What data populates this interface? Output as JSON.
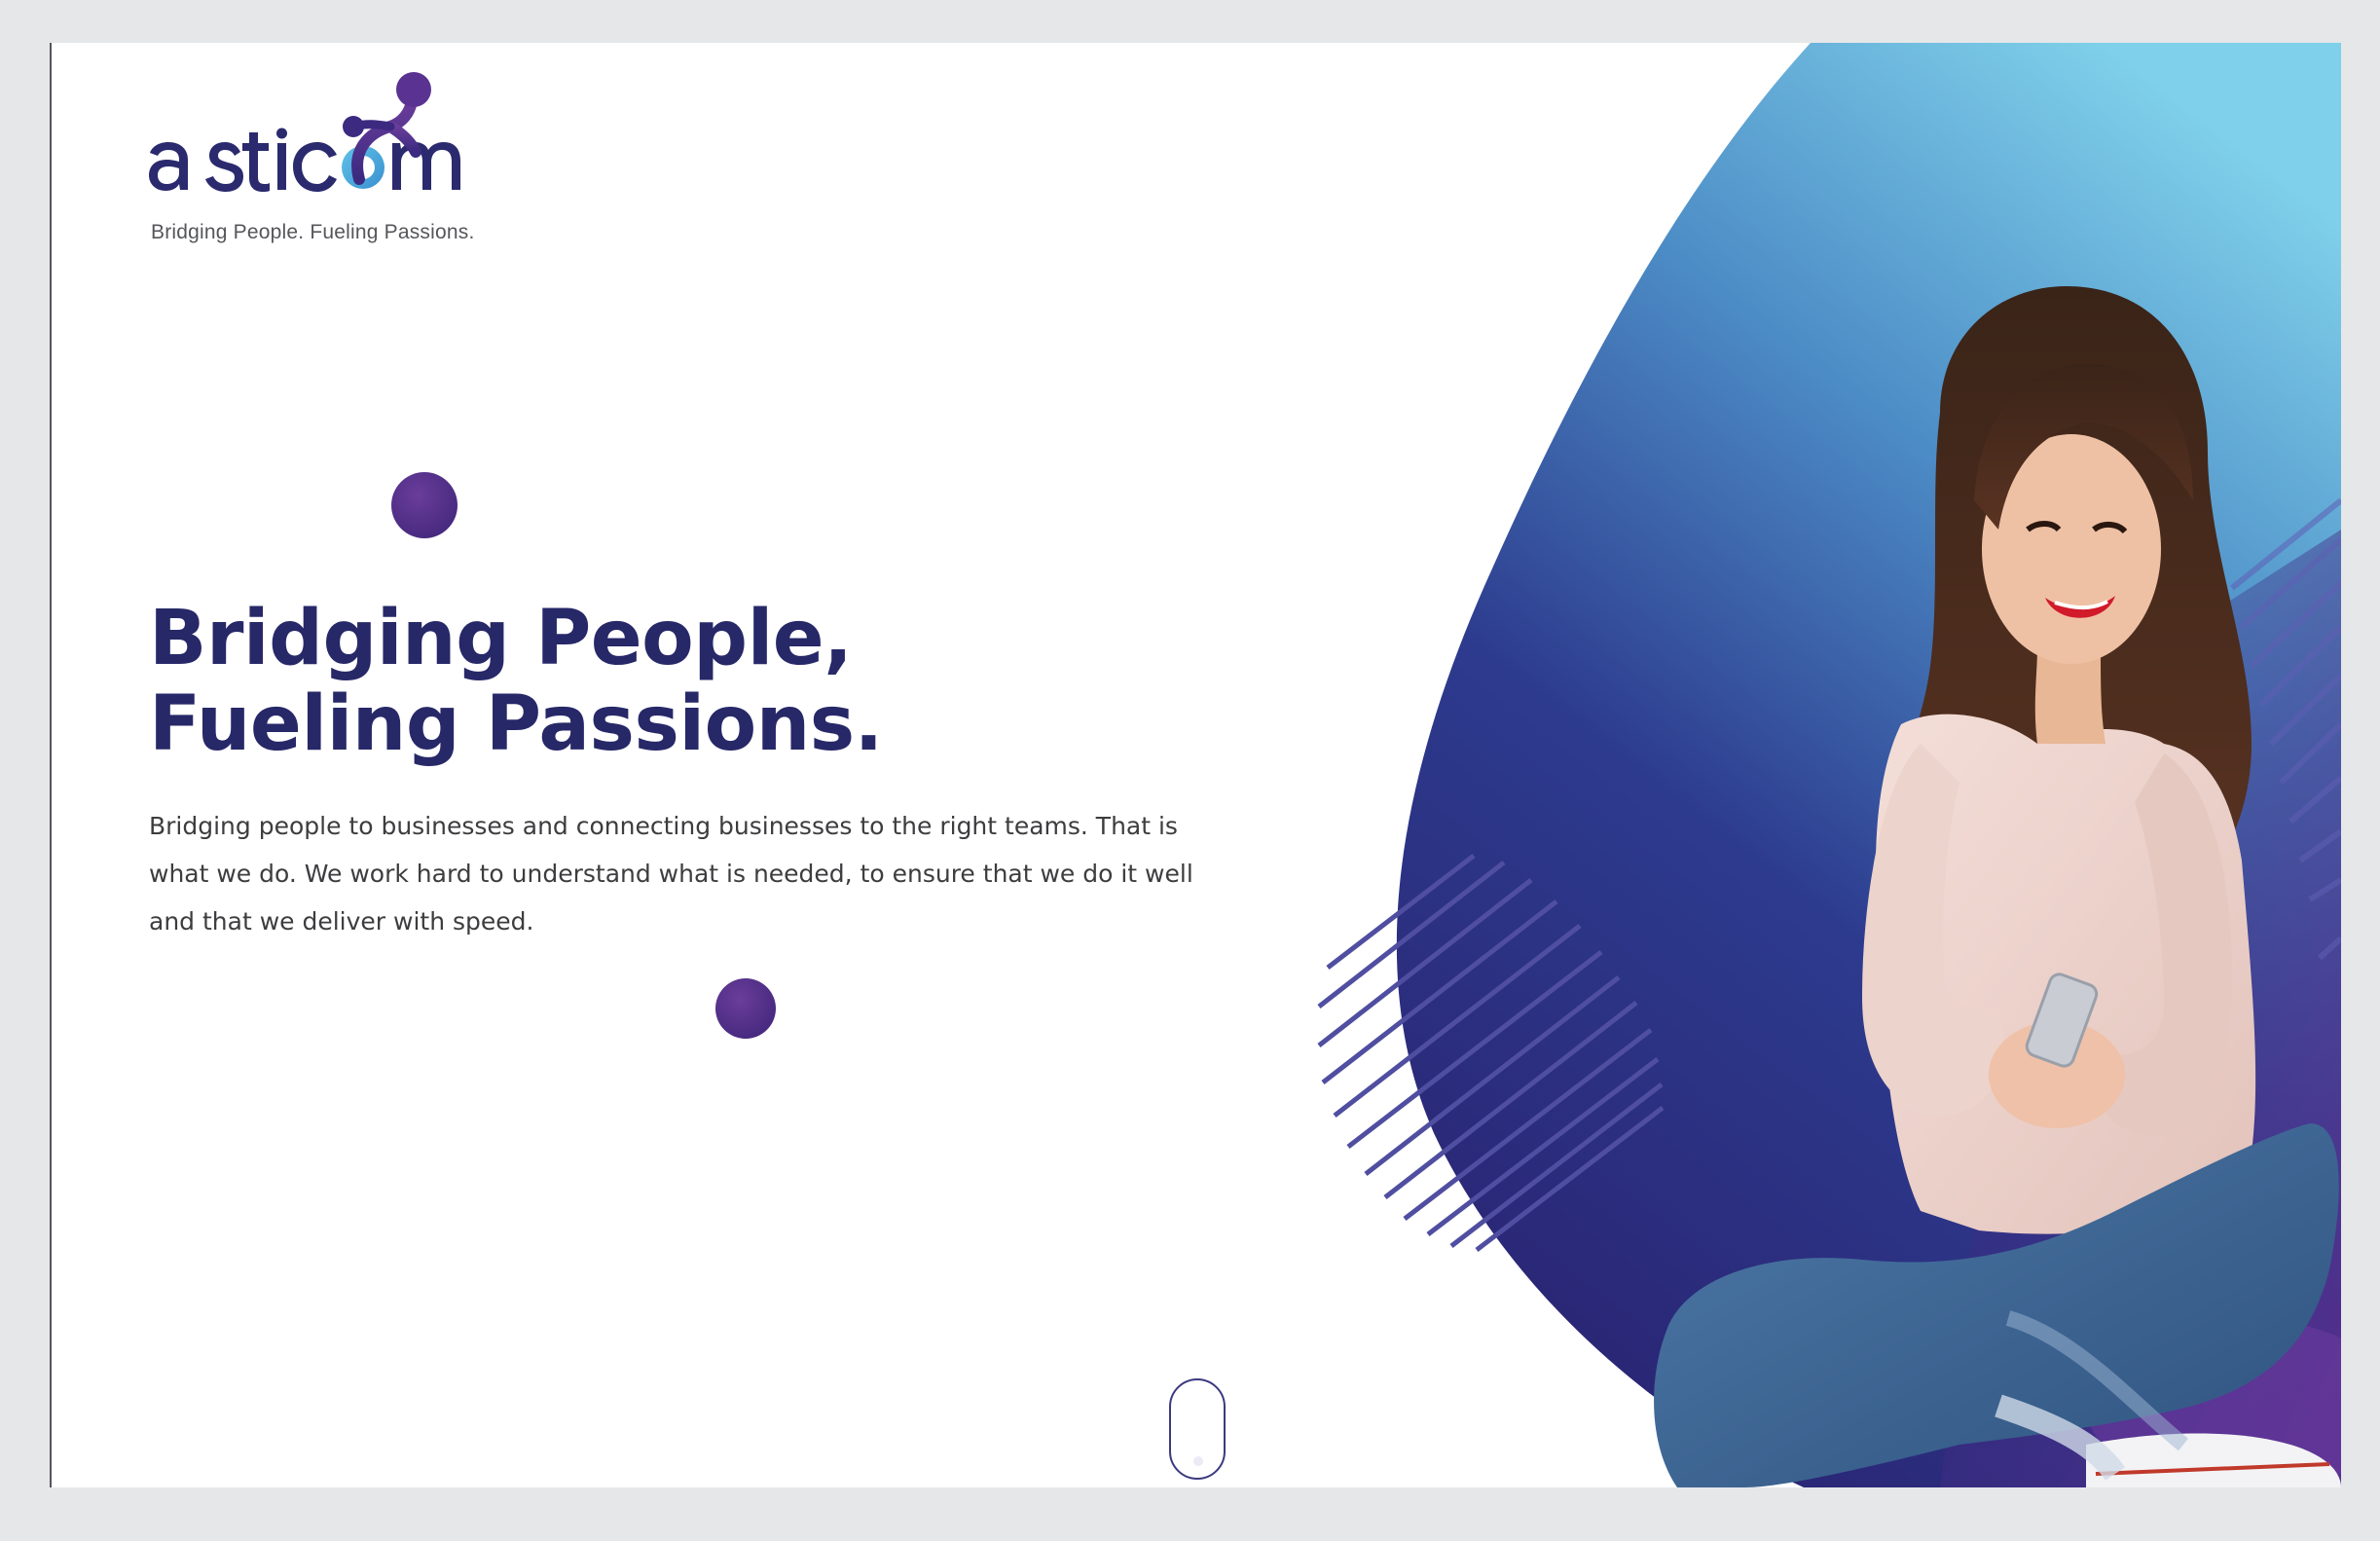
{
  "brand": {
    "logo_text": "asticom",
    "tagline": "Bridging People. Fueling Passions.",
    "primary_color": "#272868",
    "accent_purple": "#4a2b82",
    "gradient_light": "#7ccce6",
    "gradient_dark": "#2a2a7a"
  },
  "hero": {
    "title_line1": "Bridging People,",
    "title_line2": "Fueling Passions.",
    "description": "Bridging people to businesses and connecting businesses to the right teams. That is what we do. We work hard to understand what is needed, to ensure that we do it well and that we deliver with speed."
  },
  "icons": {
    "scroll": "scroll-mouse-icon",
    "logo_mark": "molecule-icon"
  }
}
